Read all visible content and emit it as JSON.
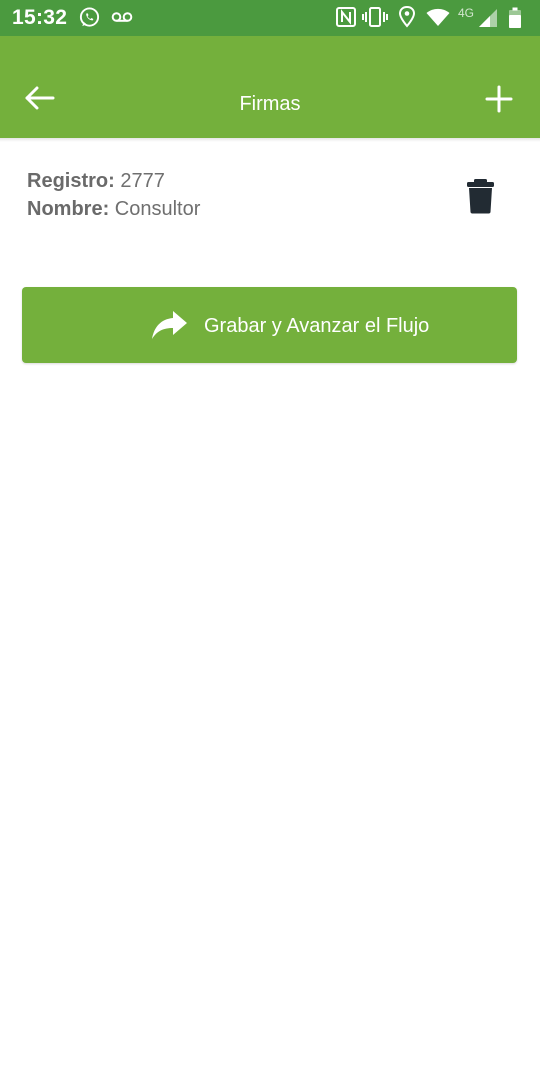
{
  "status_bar": {
    "time": "15:32",
    "network_label": "4G",
    "icons": [
      "whatsapp-icon",
      "voicemail-icon",
      "nfc-icon",
      "vibrate-icon",
      "location-icon",
      "wifi-icon",
      "signal-icon",
      "battery-icon"
    ]
  },
  "appbar": {
    "title": "Firmas",
    "back_icon": "back-arrow-icon",
    "add_icon": "plus-icon"
  },
  "record": {
    "registro_key": "Registro:",
    "registro_value": "2777",
    "nombre_key": "Nombre:",
    "nombre_value": "Consultor",
    "delete_icon": "trash-icon"
  },
  "primary_action": {
    "label": "Grabar y Avanzar el Flujo",
    "icon": "share-arrow-icon"
  },
  "colors": {
    "status_bar": "#4b9a3f",
    "appbar": "#74b03c",
    "button": "#74b03c",
    "trash": "#222b33",
    "text_gray": "#6f6f6f"
  }
}
